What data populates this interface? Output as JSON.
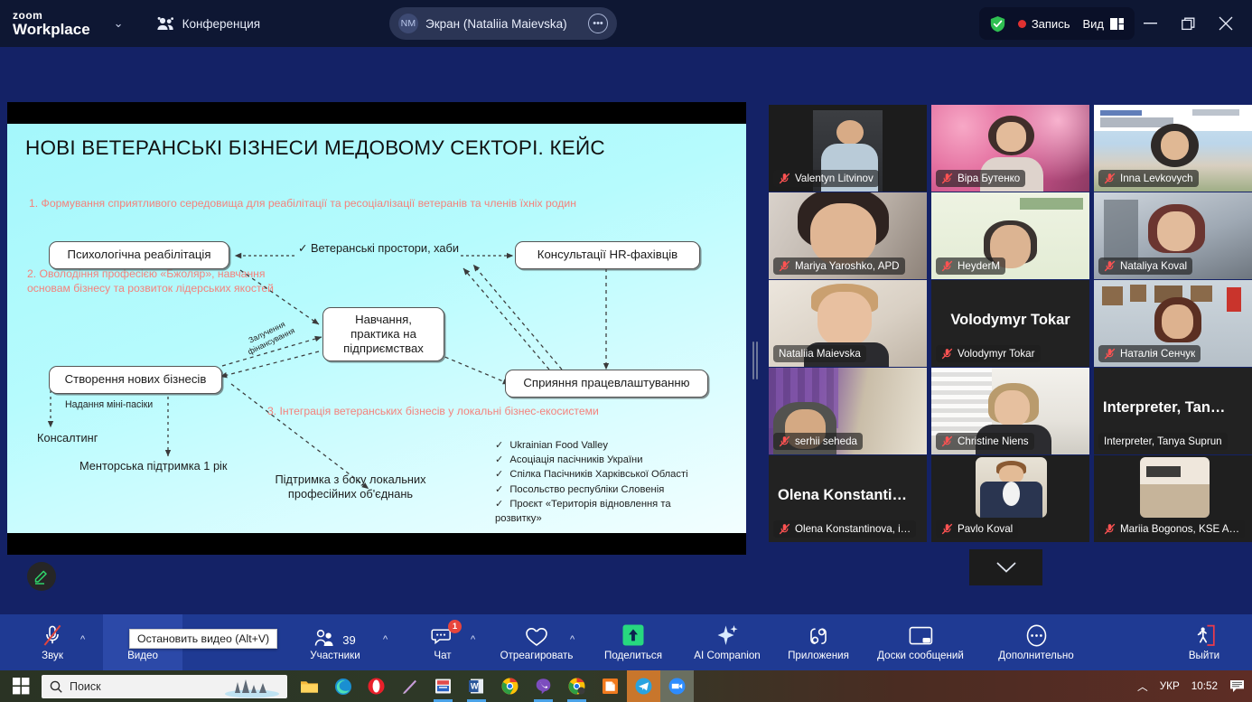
{
  "titlebar": {
    "brand_line1": "zoom",
    "brand_line2": "Workplace",
    "caret": "⌄",
    "conference_label": "Конференция",
    "conference_icon": "people-icon",
    "share_avatar_initials": "NM",
    "share_label": "Экран (Nataliia Maievska)",
    "share_more_icon": "ellipsis-icon",
    "shield_icon": "security-shield-icon",
    "recording_label": "Запись",
    "view_label": "Вид",
    "view_icon": "layout-icon",
    "minimize_icon": "minimize-icon",
    "restore_icon": "restore-window-icon",
    "close_icon": "close-icon",
    "accent_green": "#2fbf52",
    "record_red": "#e03131"
  },
  "slide": {
    "title": "НОВІ ВЕТЕРАНСЬКІ БІЗНЕСИ МЕДОВОМУ СЕКТОРІ. КЕЙС",
    "section1": "1. Формування сприятливого середовища для реабілітації та ресоціалізації ветеранів та членів їхніх родин",
    "section2": "2. Оволодіння професією «Бжоляр», навчання основам бізнесу та розвиток лідерських якостей",
    "section3": "3. Інтеграція ветеранських бізнесів у локальні бізнес-екосистеми",
    "heading_color": "#f4827c",
    "nodes": {
      "psych": "Психологічна реабілітація",
      "hubs": "Ветеранські простори, хаби",
      "hr": "Консультації HR-фахівців",
      "training": "Навчання, практика на підприємствах",
      "newbiz": "Створення нових бізнесів",
      "employment": "Сприяння працевлаштуванню",
      "funding_label": "Залучення фінансування",
      "mini_apiary": "Надання міні-пасіки",
      "consulting": "Консалтинг",
      "mentorship": "Менторська підтримка 1 рік",
      "local_support": "Підтримка з боку локальних професійних об'єднань"
    },
    "checklist": [
      "Ukrainian Food Valley",
      "Асоціація пасічників України",
      "Спілка Пасічників Харківської Області",
      "Посольство республіки Словенія",
      "Проєкт «Територія відновлення та розвитку»"
    ],
    "annotate_icon": "pencil-annotate-icon"
  },
  "participants": [
    {
      "name": "Valentyn Litvinov",
      "muted": true,
      "style": "photo-dark",
      "big": ""
    },
    {
      "name": "Віра Бутенко",
      "muted": true,
      "style": "photo-blossom",
      "big": ""
    },
    {
      "name": "Inna Levkovych",
      "muted": true,
      "style": "photo-iamo",
      "big": ""
    },
    {
      "name": "Mariya Yaroshko, APD",
      "muted": true,
      "style": "photo-room",
      "big": ""
    },
    {
      "name": "HeyderM",
      "muted": true,
      "style": "photo-green",
      "big": ""
    },
    {
      "name": "Nataliya Koval",
      "muted": true,
      "style": "photo-blur",
      "big": ""
    },
    {
      "name": "Nataliia Maievska",
      "muted": false,
      "style": "photo-light",
      "big": "",
      "active": true
    },
    {
      "name": "Volodymyr Tokar",
      "muted": true,
      "style": "name-only",
      "big": "Volodymyr Tokar"
    },
    {
      "name": "Наталія Сенчук",
      "muted": true,
      "style": "photo-frames",
      "big": ""
    },
    {
      "name": "serhii seheda",
      "muted": true,
      "style": "photo-poster",
      "big": ""
    },
    {
      "name": "Christine Niens",
      "muted": true,
      "style": "photo-window",
      "big": ""
    },
    {
      "name": "Interpreter, Tanya Suprun",
      "muted": false,
      "style": "name-only",
      "big": "Interpreter,  Tan…"
    },
    {
      "name": "Olena Konstantinova, i…",
      "muted": true,
      "style": "name-only",
      "big": "Olena  Konstanti…"
    },
    {
      "name": "Pavlo Koval",
      "muted": true,
      "style": "photo-suit",
      "big": ""
    },
    {
      "name": "Mariia Bogonos, KSE A…",
      "muted": true,
      "style": "photo-kse",
      "big": ""
    }
  ],
  "grid": {
    "more_icon": "chevron-down-icon",
    "active_outline_color": "#3ef08a",
    "mic_off_icon": "mic-off-icon"
  },
  "toolbar": {
    "items": [
      {
        "label": "Звук",
        "icon": "mic-off-icon",
        "caret": true,
        "badge": null,
        "count": null
      },
      {
        "label": "Видео",
        "icon": "video-icon",
        "caret": false,
        "badge": null,
        "count": null
      },
      {
        "label": "Участники",
        "icon": "participants-icon",
        "caret": true,
        "badge": null,
        "count": "39"
      },
      {
        "label": "Чат",
        "icon": "chat-icon",
        "caret": true,
        "badge": "1",
        "count": null
      },
      {
        "label": "Отреагировать",
        "icon": "reactions-heart-icon",
        "caret": true,
        "badge": null,
        "count": null
      },
      {
        "label": "Поделиться",
        "icon": "share-screen-icon",
        "caret": false,
        "badge": null,
        "count": null
      },
      {
        "label": "AI Companion",
        "icon": "ai-sparkle-icon",
        "caret": false,
        "badge": null,
        "count": null
      },
      {
        "label": "Приложения",
        "icon": "apps-icon",
        "caret": false,
        "badge": null,
        "count": null
      },
      {
        "label": "Доски сообщений",
        "icon": "whiteboard-icon",
        "caret": false,
        "badge": null,
        "count": null
      },
      {
        "label": "Дополнительно",
        "icon": "more-ellipsis-icon",
        "caret": false,
        "badge": null,
        "count": null
      },
      {
        "label": "Выйти",
        "icon": "leave-meeting-icon",
        "caret": false,
        "badge": null,
        "count": null
      }
    ],
    "tooltip": "Остановить видео (Alt+V)",
    "share_green": "#27d87f",
    "bar_color": "#1f3a93"
  },
  "taskbar": {
    "start_icon": "windows-start-icon",
    "search_icon": "search-icon",
    "search_placeholder": "Поиск",
    "apps": [
      "file-explorer-icon",
      "edge-icon",
      "opera-icon",
      "pen-icon",
      "paint-icon",
      "word-icon",
      "chrome-icon",
      "viber-icon",
      "chrome-beta-icon",
      "libreoffice-icon",
      "telegram-icon",
      "zoom-icon"
    ],
    "tray_chevron": "chevron-up-icon",
    "language": "УКР",
    "clock": "10:52",
    "notification_icon": "notifications-icon"
  }
}
